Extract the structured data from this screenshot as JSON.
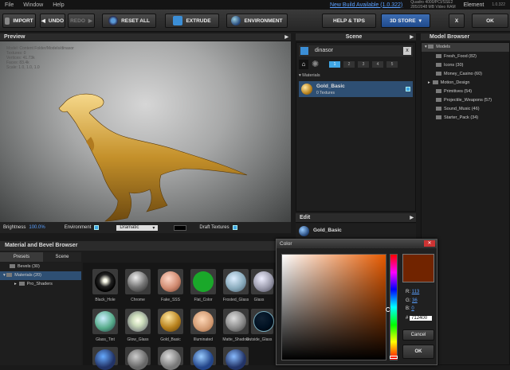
{
  "menu": {
    "items": [
      "File",
      "Window",
      "Help"
    ],
    "update_link": "New Build Available (1.0.322)",
    "gpu_line1": "Quadro 4000/PCI/SSE2",
    "gpu_line2": "285/2048 MB Video RAM",
    "element_label": "Element",
    "version": "1.0.322"
  },
  "toolbar": {
    "import": "IMPORT",
    "undo": "UNDO",
    "redo": "REDO",
    "reset_all": "RESET ALL",
    "extrude": "EXTRUDE",
    "environment": "ENVIRONMENT",
    "help_tips": "HELP & TIPS",
    "store": "3D STORE",
    "close": "X",
    "ok": "OK"
  },
  "preview": {
    "title": "Preview",
    "stats": [
      "Model: Content Folder/Models/dinasor",
      "Textures: 0",
      "Vertices: 41.73k",
      "Faces: 83.4k",
      "Scale: 1.0, 1.0, 1.0"
    ],
    "brightness_label": "Brightness",
    "brightness_value": "100.0%",
    "environment_label": "Environment",
    "environment_value": "Dramatic",
    "draft_label": "Draft Textures"
  },
  "scene": {
    "title": "Scene",
    "object_name": "dinasor",
    "groups": [
      "1",
      "2",
      "3",
      "4",
      "5"
    ],
    "materials_label": "Materials",
    "material_name": "Gold_Basic",
    "material_sub": "0 Textures"
  },
  "edit": {
    "title": "Edit",
    "material_name": "Gold_Basic"
  },
  "model_browser": {
    "title": "Model Browser",
    "root": "Models",
    "items": [
      "Fresh_Food (82)",
      "Icons (30)",
      "Money_Casino (60)",
      "Motion_Design",
      "Primitives (54)",
      "Projectile_Weapons (57)",
      "Sound_Music (46)",
      "Starter_Pack (34)"
    ]
  },
  "material_browser": {
    "title": "Material and Bevel Browser",
    "tabs": [
      "Presets",
      "Scene"
    ],
    "tree": [
      "Bevels (30)",
      "Materials (20)",
      "Pro_Shaders"
    ],
    "row1": [
      "Black_Hole",
      "Chrome",
      "Fake_SSS",
      "Flat_Color",
      "Frosted_Glass",
      "Glass"
    ],
    "row2": [
      "Glass_Tint",
      "Glow_Glass",
      "Gold_Basic",
      "Illuminated",
      "Matte_Shadow",
      "Outside_Glass"
    ]
  },
  "color_dialog": {
    "title": "Color",
    "r_label": "R:",
    "r_value": "113",
    "g_label": "G:",
    "g_value": "36",
    "b_label": "B:",
    "b_value": "0",
    "hash": "#",
    "hex_value": "712400",
    "cancel": "Cancel",
    "ok": "OK",
    "selected_color": "#712400"
  },
  "colors": {
    "accent_blue": "#3fa6e6",
    "gold": "#d4a53a"
  }
}
